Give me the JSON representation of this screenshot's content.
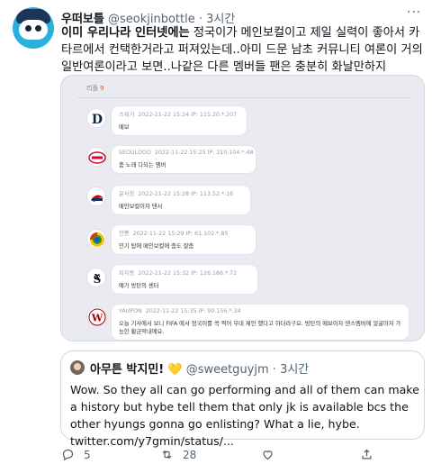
{
  "tweet": {
    "display_name": "우떠보틀",
    "handle": "@seokjinbottle",
    "separator": "·",
    "time": "3시간",
    "text_lead": "이미 우리나라 인터넷에는",
    "text_rest": " 정국이가 메인보컬이고 제일 실력이 좋아서 카타르에서 컨택한거라고 퍼져있는데..아미 드문 남초 커뮤니티 여론이 거의 일반여론이라고 보면..나같은 다른 멤버들 팬은 충분히 화날만하지"
  },
  "screenshot": {
    "reply_label": "리플",
    "reply_count": "9",
    "comments": [
      {
        "logo": "tigers-logo",
        "user": "스워거",
        "meta": "2022-11-22 15:24 IP: 115.20.*.207",
        "text": "메보"
      },
      {
        "logo": "lotte-logo",
        "user": "SEOULDOO",
        "meta": "2022-11-22 15:25 IP: 210.104.*.48",
        "text": "춤 노래 다되는 멤버"
      },
      {
        "logo": "indians-logo",
        "user": "윤사장",
        "meta": "2022-11-22 15:28 IP: 113.52.*.16",
        "text": "메인보컬이자 댄서"
      },
      {
        "logo": "wbc-logo",
        "user": "한뽕",
        "meta": "2022-11-22 15:29 IP: 61.102.*.85",
        "text": "인기 탑에 메인보컬에 춤도 잘춤"
      },
      {
        "logo": "whitesox-logo",
        "user": "피자왕",
        "meta": "2022-11-22 15:32 IP: 126.186.*.72",
        "text": "얘가 방탄의 센터"
      },
      {
        "logo": "nationals-logo",
        "user": "YAUPON",
        "meta": "2022-11-22 15:35 IP: 99.156.*.34",
        "text": "오늘 기사에서 보니 FIFA 에서 정국이를 콕 찍어 무대 제안 했다고 하더라구요. 방탄의 메보이자 댄스멤버에 얼굴마저 가능한 황금막내에요."
      }
    ]
  },
  "quote": {
    "display_name": "아무튼 박지민!",
    "heart": "💛",
    "handle": "@sweetguyjm",
    "separator": "·",
    "time": "3시간",
    "text": "Wow. So they all can go performing and all of them can make a history but hybe tell them that only jk is available bcs the other hyungs gonna go enlisting? What a lie, hybe. twitter.com/y7gmin/status/..."
  },
  "actions": {
    "reply_count": "5",
    "retweet_count": "28",
    "like_count": "",
    "share_count": ""
  },
  "colors": {
    "accent": "#1d9bf0",
    "muted": "#536471",
    "reply_count": "#e0562c"
  }
}
